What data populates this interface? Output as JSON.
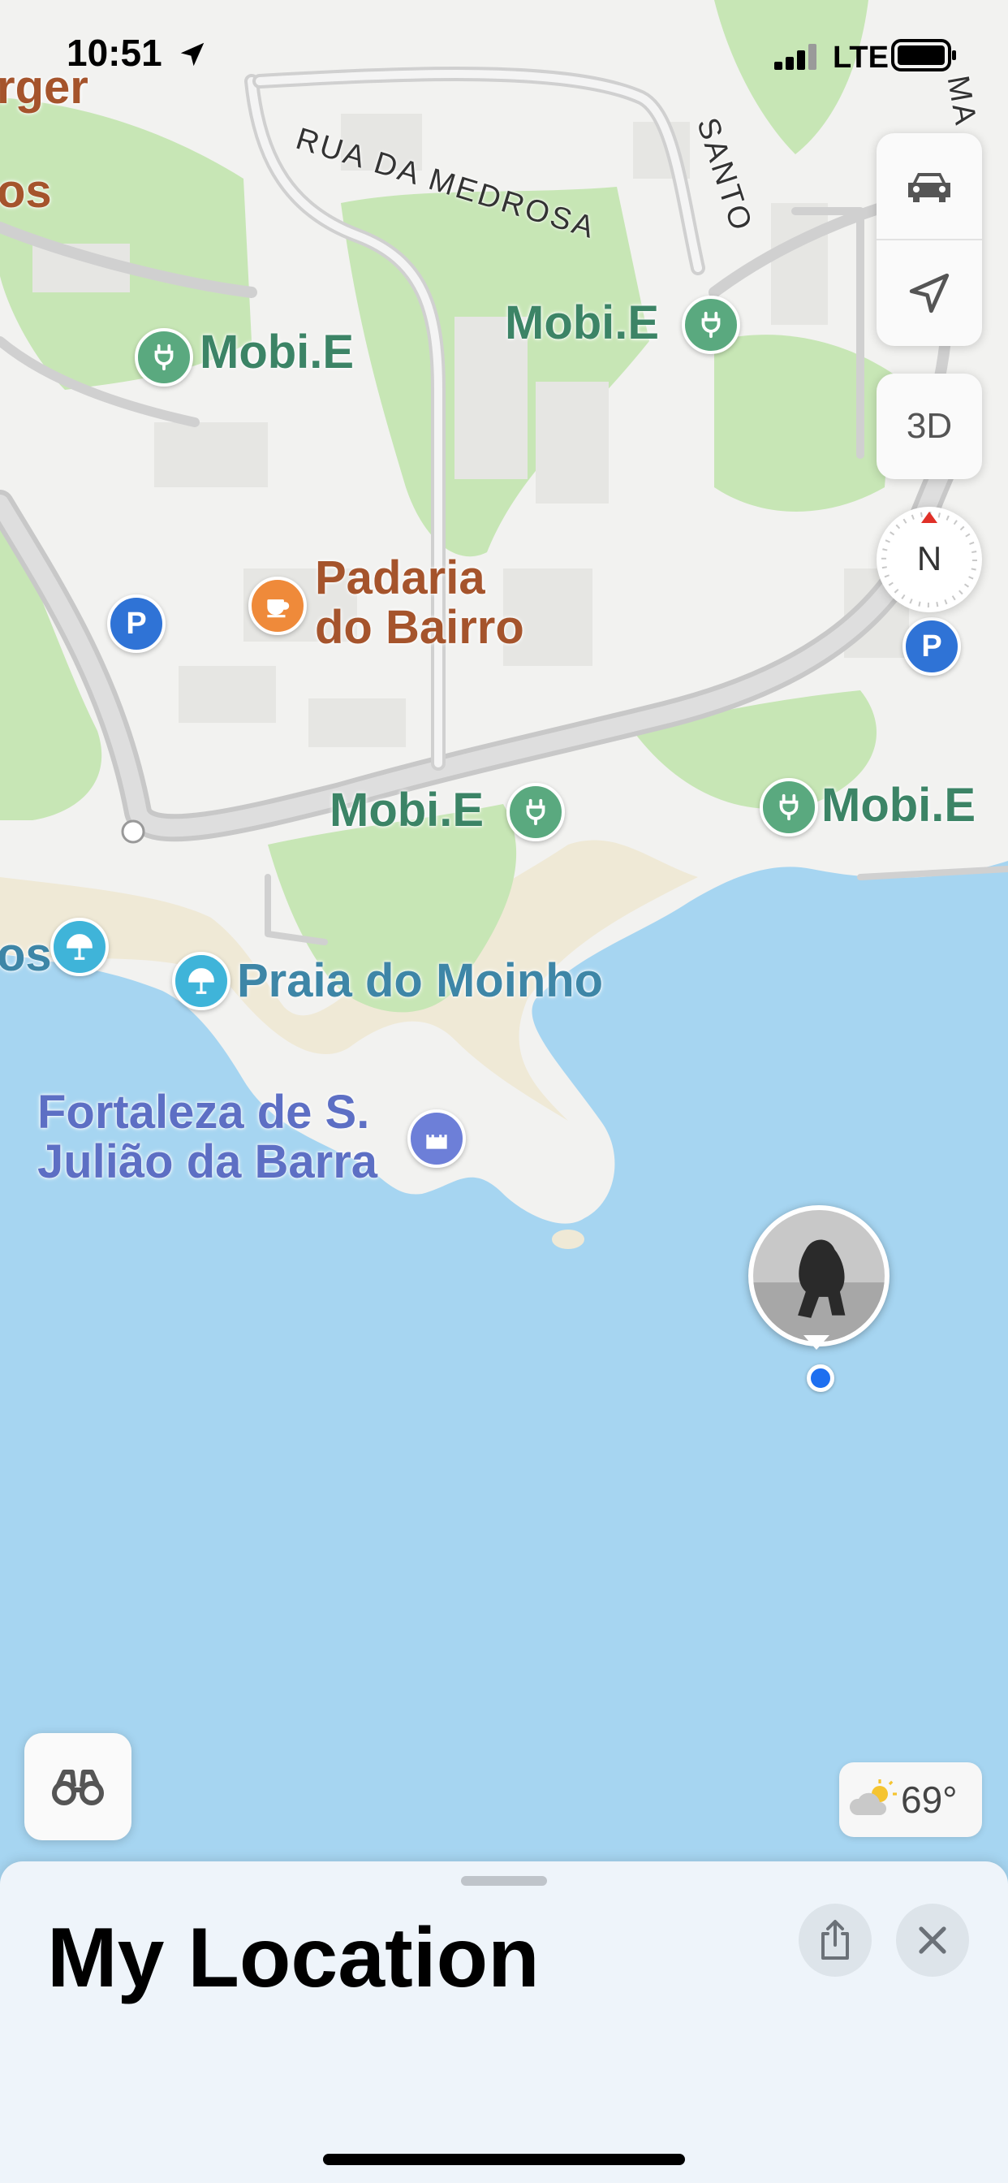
{
  "status_bar": {
    "time": "10:51",
    "network": "LTE"
  },
  "map_labels": {
    "streets": {
      "rua_da_medrosa": "RUA DA MEDROSA",
      "santo": "SANTO",
      "partial_top_right": "MA"
    },
    "partial_left_top": "rger",
    "partial_left_second": "os",
    "partial_left_beach": "os",
    "poi": {
      "mobie_1": "Mobi.E",
      "mobie_2": "Mobi.E",
      "mobie_3": "Mobi.E",
      "mobie_4": "Mobi.E",
      "padaria_line1": "Padaria",
      "padaria_line2": "do Bairro",
      "praia": "Praia do Moinho",
      "fortaleza_line1": "Fortaleza de S.",
      "fortaleza_line2": "Julião da Barra"
    },
    "parking": "P"
  },
  "map_controls": {
    "mode_icon": "car-icon",
    "location_icon": "location-arrow-icon",
    "view_3d_label": "3D",
    "compass_label": "N"
  },
  "lookaround_icon": "binoculars-icon",
  "weather": {
    "temperature": "69°",
    "icon": "partly-cloudy-icon"
  },
  "bottom_sheet": {
    "title": "My Location",
    "share_icon": "share-icon",
    "close_icon": "close-icon"
  },
  "colors": {
    "water": "#a6d5f1",
    "land": "#f2f2f0",
    "park": "#c7e6b5",
    "sand": "#efe9d6",
    "road": "#bfbfbf",
    "charger_green": "#5aa97f",
    "parking_blue": "#2f73d6",
    "beach_teal": "#3fb4d9",
    "landmark_purple": "#6d7fd8",
    "cafe_orange": "#ef8a3a"
  }
}
